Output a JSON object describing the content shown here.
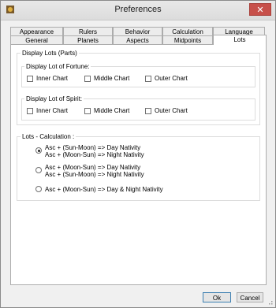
{
  "window": {
    "title": "Preferences",
    "close_glyph": "✕"
  },
  "tabs": {
    "row1": [
      "Appearance",
      "Rulers",
      "Behavior",
      "Calculation",
      "Language"
    ],
    "row2": [
      "General",
      "Planets",
      "Aspects",
      "Midpoints",
      "Lots"
    ],
    "active": "Lots"
  },
  "display_lots": {
    "title": "Display Lots (Parts)",
    "fortune": {
      "title": "Display Lot of Fortune:",
      "options": [
        "Inner Chart",
        "Middle Chart",
        "Outer Chart"
      ]
    },
    "spirit": {
      "title": "Display Lot of Spirit:",
      "options": [
        "Inner Chart",
        "Middle Chart",
        "Outer Chart"
      ]
    }
  },
  "calculation": {
    "title": "Lots  - Calculation :",
    "options": [
      {
        "line1": "Asc + (Sun-Moon)  => Day Nativity",
        "line2": "Asc + (Moon-Sun) => Night Nativity",
        "checked": true
      },
      {
        "line1": "Asc + (Moon-Sun)  => Day Nativity",
        "line2": "Asc + (Sun-Moon) => Night Nativity",
        "checked": false
      },
      {
        "line1": "Asc + (Moon-Sun) => Day & Night Nativity",
        "line2": "",
        "checked": false
      }
    ]
  },
  "buttons": {
    "ok": "Ok",
    "cancel": "Cancel"
  },
  "colors": {
    "close": "#c7504a",
    "panel": "#ffffff",
    "window": "#f0f0f0"
  },
  "icons": {
    "app": "app-icon",
    "close": "close-icon",
    "grip": "resize-grip-icon"
  }
}
